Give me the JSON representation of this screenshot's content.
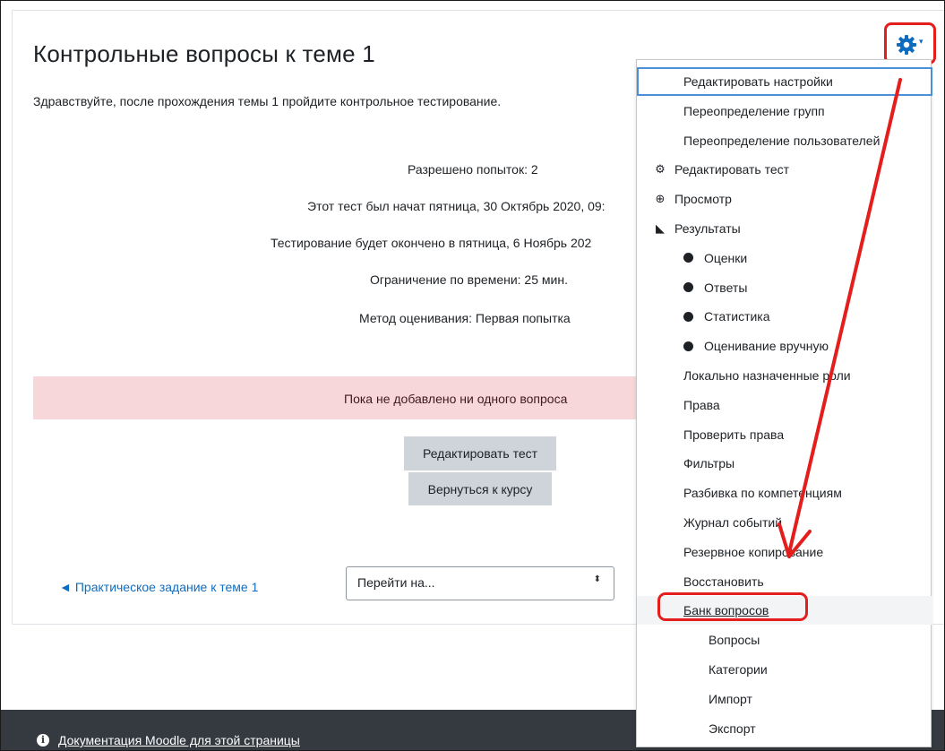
{
  "page": {
    "title": "Контрольные вопросы к теме 1",
    "intro": "Здравствуйте, после прохождения темы 1 пройдите контрольное тестирование."
  },
  "quiz_info": {
    "attempts": "Разрешено попыток: 2",
    "opened": "Этот тест был начат пятница, 30 Октябрь 2020, 09:",
    "closes": "Тестирование будет окончено в пятница, 6 Ноябрь 202",
    "time_limit": "Ограничение по времени: 25 мин.",
    "grading": "Метод оценивания: Первая попытка"
  },
  "alert": {
    "text": "Пока не добавлено ни одного вопроса"
  },
  "buttons": {
    "edit_quiz": "Редактировать тест",
    "back_to_course": "Вернуться к курсу"
  },
  "navigation": {
    "prev_arrow": "◄",
    "prev_link": "Практическое задание к теме 1",
    "jump_placeholder": "Перейти на...",
    "jump_caret": "⬍"
  },
  "footer": {
    "info_glyph": "i",
    "doc_link": "Документация Moodle для этой страницы"
  },
  "settings_menu": {
    "gear_caret": "▾",
    "items": [
      {
        "label": "Редактировать настройки",
        "icon": "",
        "level": 0
      },
      {
        "label": "Переопределение групп",
        "icon": "",
        "level": 0
      },
      {
        "label": "Переопределение пользователей",
        "icon": "",
        "level": 0
      },
      {
        "label": "Редактировать тест",
        "icon": "gear-icon",
        "level": 0
      },
      {
        "label": "Просмотр",
        "icon": "search-plus-icon",
        "level": 0
      },
      {
        "label": "Результаты",
        "icon": "area-chart-icon",
        "level": 0
      },
      {
        "label": "Оценки",
        "icon": "dot-icon",
        "level": 1
      },
      {
        "label": "Ответы",
        "icon": "dot-icon",
        "level": 1
      },
      {
        "label": "Статистика",
        "icon": "dot-icon",
        "level": 1
      },
      {
        "label": "Оценивание вручную",
        "icon": "dot-icon",
        "level": 1
      },
      {
        "label": "Локально назначенные роли",
        "icon": "",
        "level": 0
      },
      {
        "label": "Права",
        "icon": "",
        "level": 0
      },
      {
        "label": "Проверить права",
        "icon": "",
        "level": 0
      },
      {
        "label": "Фильтры",
        "icon": "",
        "level": 0
      },
      {
        "label": "Разбивка по компетенциям",
        "icon": "",
        "level": 0
      },
      {
        "label": "Журнал событий",
        "icon": "",
        "level": 0
      },
      {
        "label": "Резервное копирование",
        "icon": "",
        "level": 0
      },
      {
        "label": "Восстановить",
        "icon": "",
        "level": 0
      },
      {
        "label": "Банк вопросов",
        "icon": "",
        "level": 0
      },
      {
        "label": "Вопросы",
        "icon": "",
        "level": 2
      },
      {
        "label": "Категории",
        "icon": "",
        "level": 2
      },
      {
        "label": "Импорт",
        "icon": "",
        "level": 2
      },
      {
        "label": "Экспорт",
        "icon": "",
        "level": 2
      }
    ]
  },
  "colors": {
    "annotation_red": "#e41d1d",
    "link_blue": "#0f6cbf",
    "alert_bg": "#f8d7da",
    "footer_bg": "#343a40",
    "button_bg": "#ced4da"
  }
}
